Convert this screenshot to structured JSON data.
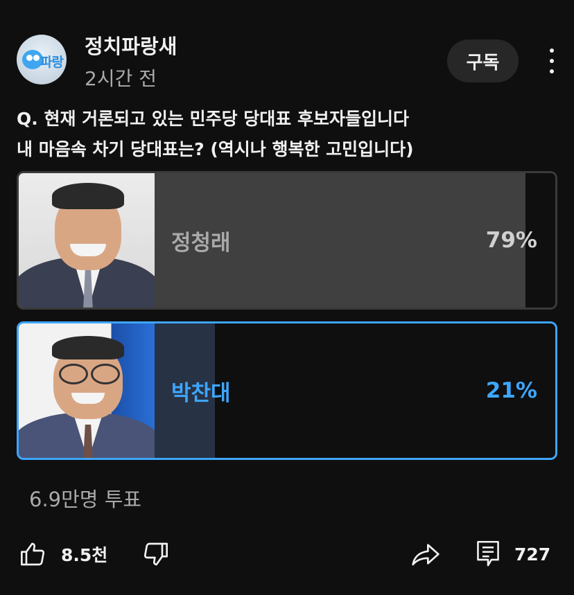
{
  "channel": {
    "name": "정치파랑새",
    "time_ago": "2시간 전",
    "logo_text": "파랑"
  },
  "subscribe_label": "구독",
  "poll": {
    "question_lines": [
      "Q. 현재 거론되고 있는 민주당 당대표 후보자들입니다",
      "내 마음속 차기 당대표는? (역시나 행복한 고민입니다)"
    ],
    "options": [
      {
        "name": "정청래",
        "percent_label": "79%",
        "percent": 79,
        "selected": false
      },
      {
        "name": "박찬대",
        "percent_label": "21%",
        "percent": 21,
        "selected": true
      }
    ],
    "total_votes": "6.9만명 투표"
  },
  "actions": {
    "like_count": "8.5천",
    "comment_count": "727"
  },
  "colors": {
    "accent": "#3ea6ff",
    "background": "#0f0f0f",
    "muted_text": "#aaaaaa"
  },
  "icons": [
    "thumbs-up-icon",
    "thumbs-down-icon",
    "share-icon",
    "comment-icon",
    "more-vertical-icon"
  ]
}
